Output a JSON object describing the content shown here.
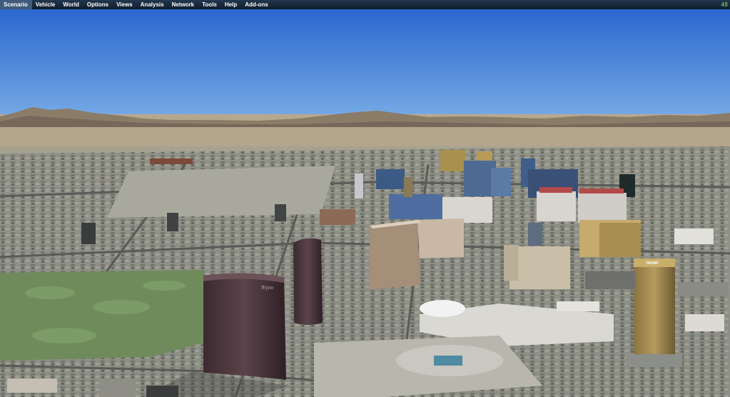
{
  "menu": {
    "items": [
      {
        "label": "Scenario"
      },
      {
        "label": "Vehicle"
      },
      {
        "label": "World"
      },
      {
        "label": "Options"
      },
      {
        "label": "Views"
      },
      {
        "label": "Analysis"
      },
      {
        "label": "Network"
      },
      {
        "label": "Tools"
      },
      {
        "label": "Help"
      },
      {
        "label": "Add-ons"
      }
    ]
  },
  "status": {
    "frame_rate": "48"
  },
  "scene": {
    "sky_top_color": "#2a67cf",
    "sky_horizon_color": "#7aaee6",
    "mountain_color": "#8b7c68",
    "desert_color": "#b7a98e",
    "golf_course_color": "#6f8b5c",
    "signs": {
      "wynn_tower": "Wynn",
      "trump_tower": "TRUMP"
    }
  }
}
